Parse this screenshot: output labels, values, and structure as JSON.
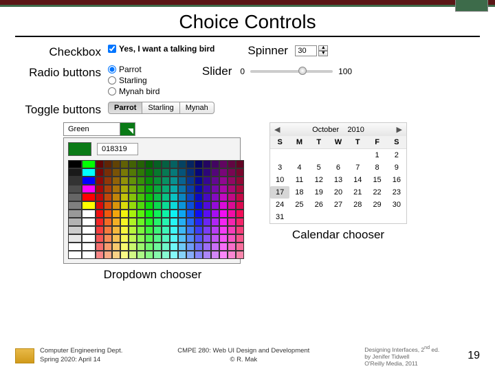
{
  "title": "Choice Controls",
  "labels": {
    "checkbox": "Checkbox",
    "radio": "Radio buttons",
    "toggle": "Toggle buttons",
    "spinner": "Spinner",
    "slider": "Slider",
    "dropdown": "Dropdown chooser",
    "calendar": "Calendar chooser"
  },
  "checkbox": {
    "label": "Yes, I want a talking bird",
    "checked": true
  },
  "radio": {
    "options": [
      "Parrot",
      "Starling",
      "Mynah bird"
    ],
    "selected": "Parrot"
  },
  "toggle": {
    "options": [
      "Parrot",
      "Starling",
      "Mynah"
    ],
    "active": "Parrot"
  },
  "spinner": {
    "value": "30"
  },
  "slider": {
    "min": "0",
    "max": "100"
  },
  "dropdown": {
    "selected_label": "Green",
    "hex": "018319"
  },
  "calendar": {
    "month": "October",
    "year": "2010",
    "day_headers": [
      "S",
      "M",
      "T",
      "W",
      "T",
      "F",
      "S"
    ],
    "weeks": [
      [
        "",
        "",
        "",
        "",
        "",
        "1",
        "2"
      ],
      [
        "3",
        "4",
        "5",
        "6",
        "7",
        "8",
        "9"
      ],
      [
        "10",
        "11",
        "12",
        "13",
        "14",
        "15",
        "16"
      ],
      [
        "17",
        "18",
        "19",
        "20",
        "21",
        "22",
        "23"
      ],
      [
        "24",
        "25",
        "26",
        "27",
        "28",
        "29",
        "30"
      ],
      [
        "31",
        "",
        "",
        "",
        "",
        "",
        ""
      ]
    ],
    "selected_day": "17"
  },
  "footer": {
    "dept1": "Computer Engineering Dept.",
    "dept2": "Spring 2020: April 14",
    "center1": "CMPE 280: Web UI Design and Development",
    "center2": "© R. Mak",
    "cite1": "Designing Interfaces, 2",
    "cite1_sup": "nd",
    "cite1_tail": " ed.",
    "cite2": "by Jenifer Tidwell",
    "cite3": "O'Reilly Media, 2011",
    "page": "19"
  },
  "color_grid": {
    "grays": [
      "#000",
      "#1a1a1a",
      "#333",
      "#4d4d4d",
      "#666",
      "#808080",
      "#999",
      "#b3b3b3",
      "#ccc",
      "#e6e6e6",
      "#fff",
      "#fff"
    ],
    "brights": [
      "#00ff00",
      "#00ffff",
      "#0000ff",
      "#ff00ff",
      "#ff0000",
      "#ffff00",
      "#fff",
      "#fff",
      "#fff",
      "#fff",
      "#fff",
      "#fff"
    ],
    "hues_base": [
      "#400",
      "#800",
      "#b00",
      "#f00",
      "#f44",
      "#f88",
      "#840",
      "#b70",
      "#fa0",
      "#fc4",
      "#880",
      "#bb0",
      "#ff0",
      "#480",
      "#7b0",
      "#af0",
      "#080",
      "#0b0"
    ],
    "row_mixes": [
      [
        "#004",
        "#008",
        "#00b",
        "#00f",
        "#44f",
        "#88f"
      ],
      [
        "#040",
        "#080",
        "#0b0",
        "#0f0",
        "#4f4",
        "#8f8"
      ],
      [
        "#044",
        "#088",
        "#0bb",
        "#0ff",
        "#4ff",
        "#8ff"
      ],
      [
        "#404",
        "#808",
        "#b0b",
        "#f0f",
        "#f4f",
        "#f8f"
      ],
      [
        "#440",
        "#880",
        "#bb0",
        "#ff0",
        "#ff4",
        "#ff8"
      ],
      [
        "#024",
        "#048",
        "#06b",
        "#08f",
        "#4af",
        "#8cf"
      ]
    ]
  }
}
